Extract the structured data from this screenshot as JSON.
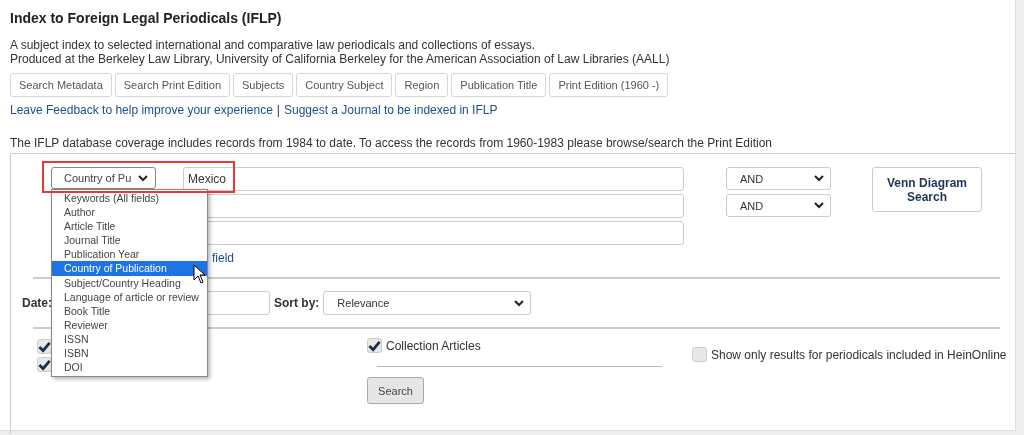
{
  "title": "Index to Foreign Legal Periodicals (IFLP)",
  "description": [
    "A subject index to selected international and comparative law periodicals and collections of essays.",
    "Produced at the Berkeley Law Library, University of California Berkeley for the American Association of Law Libraries (AALL)"
  ],
  "tabs": [
    "Search Metadata",
    "Search Print Edition",
    "Subjects",
    "Country Subject",
    "Region",
    "Publication Title",
    "Print Edition (1960 -)"
  ],
  "links": [
    {
      "kind": "link",
      "text": "Leave Feedback to help improve your experience"
    },
    {
      "kind": "separator",
      "text": "|"
    },
    {
      "kind": "link",
      "text": "Suggest a Journal to be indexed in IFLP"
    }
  ],
  "coverage": "The IFLP database coverage includes records from 1984 to date. To access the records from 1960-1983 please browse/search the Print Edition",
  "search": {
    "field_select": {
      "value": "Country of Pu",
      "highlighted": true
    },
    "rows": [
      {
        "value": "Mexico"
      },
      {},
      {}
    ],
    "operators": [
      "AND",
      "AND"
    ],
    "venn_button": "Venn Diagram Search",
    "add_field_link": "field",
    "dropdown": [
      {
        "label": "Keywords (All fields)",
        "selected": false
      },
      {
        "label": "Author",
        "selected": false
      },
      {
        "label": "Article Title",
        "selected": false
      },
      {
        "label": "Journal Title",
        "selected": false
      },
      {
        "label": "Publication Year",
        "selected": false
      },
      {
        "label": "Country of Publication",
        "selected": true
      },
      {
        "label": "Subject/Country Heading",
        "selected": false
      },
      {
        "label": "Language of article or review",
        "selected": false
      },
      {
        "label": "Book Title",
        "selected": false
      },
      {
        "label": "Reviewer",
        "selected": false
      },
      {
        "label": "ISSN",
        "selected": false
      },
      {
        "label": "ISBN",
        "selected": false
      },
      {
        "label": "DOI",
        "selected": false
      }
    ]
  },
  "date_label": "Date:",
  "sort": {
    "label": "Sort by:",
    "value": "Relevance"
  },
  "type_checkboxes": [
    {
      "checked": true
    },
    {
      "checked": true
    }
  ],
  "collection": {
    "label": "Collection Articles",
    "checked": true
  },
  "hein": {
    "label": "Show only results for periodicals included in HeinOnline",
    "checked": false
  },
  "search_button": "Search"
}
